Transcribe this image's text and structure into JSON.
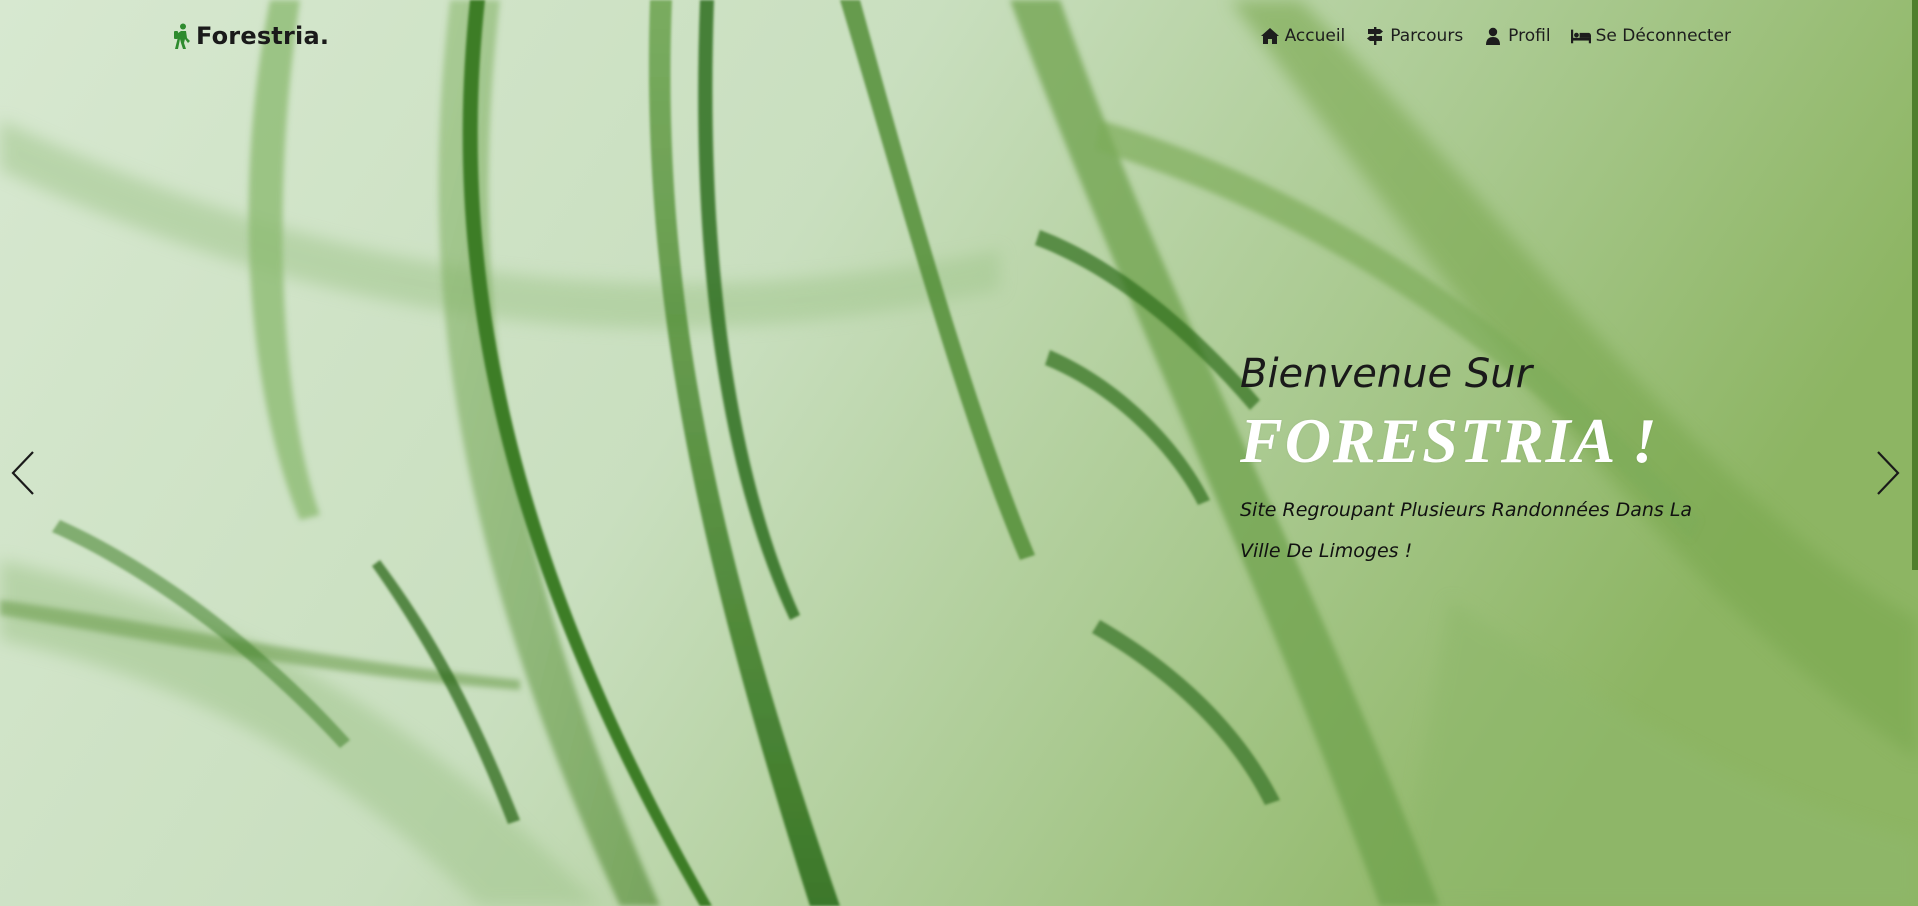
{
  "brand": {
    "name": "Forestria.",
    "icon": "hiker-icon",
    "icon_color": "#2e8b2e"
  },
  "nav": {
    "items": [
      {
        "label": "Accueil",
        "icon": "home-icon"
      },
      {
        "label": "Parcours",
        "icon": "signpost-icon"
      },
      {
        "label": "Profil",
        "icon": "user-icon"
      },
      {
        "label": "Se Déconnecter",
        "icon": "bed-icon"
      }
    ]
  },
  "hero": {
    "welcome": "Bienvenue Sur",
    "site_name": "FORESTRIA !",
    "subtitle": "Site Regroupant Plusieurs Randonnées Dans La Ville De Limoges !"
  },
  "carousel": {
    "prev_icon": "chevron-left-icon",
    "next_icon": "chevron-right-icon"
  },
  "colors": {
    "background_light": "#d5e6cc",
    "leaf_green": "#3f7f2a",
    "accent_strip": "#4f7f2d"
  }
}
